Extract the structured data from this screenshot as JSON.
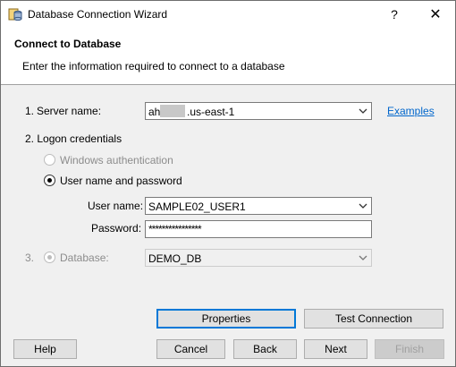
{
  "window": {
    "title": "Database Connection Wizard",
    "help_label": "?",
    "close_label": "✕"
  },
  "header": {
    "title": "Connect to Database",
    "subtitle": "Enter the information required to connect to a database"
  },
  "server": {
    "number": "1.",
    "label": "Server name:",
    "value_prefix": "ah9",
    "value_suffix": ".us-east-1",
    "examples_link": "Examples"
  },
  "logon": {
    "label": "2. Logon credentials",
    "windows_auth_label": "Windows authentication",
    "userpass_label": "User name and password",
    "selected": "userpass",
    "username_label": "User name:",
    "username_value": "SAMPLE02_USER1",
    "password_label": "Password:",
    "password_value": "****************"
  },
  "database": {
    "number": "3.",
    "label": "Database:",
    "value": "DEMO_DB"
  },
  "buttons": {
    "properties": "Properties",
    "test_connection": "Test Connection",
    "help": "Help",
    "cancel": "Cancel",
    "back": "Back",
    "next": "Next",
    "finish": "Finish"
  },
  "icons": {
    "app": "database-wizard-icon",
    "dropdown": "chevron-down-icon"
  },
  "colors": {
    "accent": "#0078d7",
    "link": "#0066cc"
  }
}
